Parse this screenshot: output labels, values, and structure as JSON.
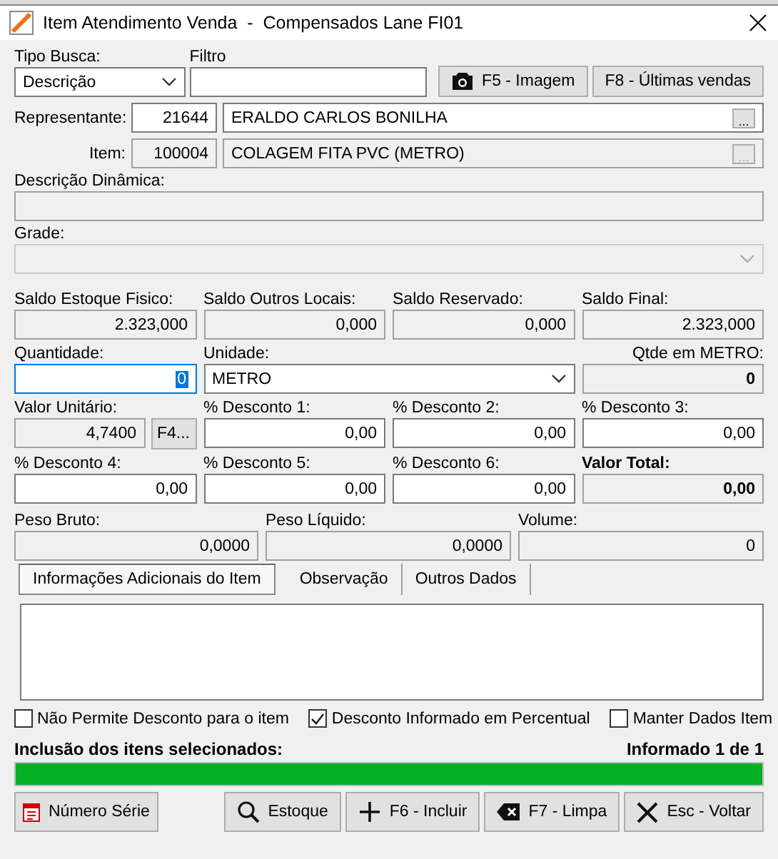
{
  "window": {
    "title": "Item Atendimento Venda  -  Compensados Lane FI01"
  },
  "search": {
    "type_label": "Tipo Busca:",
    "type_value": "Descrição",
    "filter_label": "Filtro",
    "buttons": [
      {
        "label": "F5 - Imagem",
        "kind": "camera"
      },
      {
        "label": "F8 - Últimas vendas",
        "kind": "plain"
      }
    ]
  },
  "lookups": [
    {
      "label": "Representante:",
      "code": "21644",
      "name": "ERALDO CARLOS BONILHA",
      "browse": "...",
      "disabled": false
    },
    {
      "label": "Item:",
      "code": "100004",
      "name": "COLAGEM FITA PVC (METRO)",
      "browse": "...",
      "disabled": true
    }
  ],
  "descricao_dinamica": {
    "label": "Descrição Dinâmica:"
  },
  "grade": {
    "label": "Grade:"
  },
  "fields": [
    {
      "label": "Saldo Estoque Fisico:",
      "value": "2.323,000",
      "kind": "text",
      "readonly": true,
      "focused": false
    },
    {
      "label": "Saldo Outros Locais:",
      "value": "0,000",
      "kind": "text",
      "readonly": true,
      "focused": false
    },
    {
      "label": "Saldo Reservado:",
      "value": "0,000",
      "kind": "text",
      "readonly": true,
      "focused": false
    },
    {
      "label": "Saldo Final:",
      "value": "2.323,000",
      "kind": "text",
      "readonly": true,
      "focused": false
    },
    {
      "label": "Quantidade:",
      "value": "0",
      "kind": "text",
      "readonly": false,
      "focused": true
    },
    {
      "label": "Unidade:",
      "value": "METRO",
      "kind": "select",
      "readonly": false,
      "focused": false
    },
    {
      "label": "Qtde em METRO:",
      "value": "0",
      "kind": "total",
      "readonly": true,
      "focused": false
    },
    {
      "label": "Valor Unitário:",
      "value": "4,7400",
      "kind": "text_button",
      "button": "F4...",
      "readonly": true,
      "focused": false
    },
    {
      "label": "% Desconto 1:",
      "value": "0,00",
      "kind": "text",
      "readonly": false,
      "focused": false
    },
    {
      "label": "% Desconto 2:",
      "value": "0,00",
      "kind": "text",
      "readonly": false,
      "focused": false
    },
    {
      "label": "% Desconto 3:",
      "value": "0,00",
      "kind": "text",
      "readonly": false,
      "focused": false
    },
    {
      "label": "% Desconto 4:",
      "value": "0,00",
      "kind": "text",
      "readonly": false,
      "focused": false
    },
    {
      "label": "% Desconto 5:",
      "value": "0,00",
      "kind": "text",
      "readonly": false,
      "focused": false
    },
    {
      "label": "% Desconto 6:",
      "value": "0,00",
      "kind": "text",
      "readonly": false,
      "focused": false
    },
    {
      "label": "Valor Total:",
      "value": "0,00",
      "kind": "bold_total",
      "readonly": true,
      "focused": false
    }
  ],
  "weights": [
    {
      "label": "Peso Bruto:",
      "value": "0,0000"
    },
    {
      "label": "Peso Líquido:",
      "value": "0,0000"
    },
    {
      "label": "Volume:",
      "value": "0"
    }
  ],
  "tabs": [
    {
      "label": "Informações Adicionais do Item",
      "selected": true
    },
    {
      "label": "Observação",
      "selected": false
    },
    {
      "label": "Outros Dados",
      "selected": false
    }
  ],
  "options": [
    {
      "label": "Não Permite Desconto para o item",
      "checked": false
    },
    {
      "label": "Desconto Informado em Percentual",
      "checked": true
    },
    {
      "label": "Manter Dados Item",
      "checked": false
    }
  ],
  "progress": {
    "label": "Inclusão dos itens selecionados:",
    "status": "Informado 1 de 1",
    "level": 1
  },
  "buttons": [
    {
      "label": "Número Série",
      "kind": "calendar"
    },
    {
      "label": "Estoque",
      "kind": "search"
    },
    {
      "label": "F6 - Incluir",
      "kind": "plus"
    },
    {
      "label": "F7 - Limpa",
      "kind": "erase"
    },
    {
      "label": "Esc - Voltar",
      "kind": "close"
    }
  ]
}
